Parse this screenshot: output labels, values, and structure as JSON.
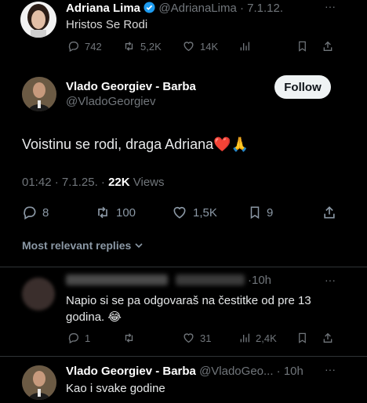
{
  "tweet1": {
    "name": "Adriana Lima",
    "handle_time": "@AdrianaLima · 7.1.12.",
    "text": "Hristos Se Rodi",
    "replies": "742",
    "retweets": "5,2K",
    "likes": "14K",
    "more": "···"
  },
  "main": {
    "name": "Vlado Georgiev - Barba",
    "handle": "@VladoGeorgiev",
    "follow_label": "Follow",
    "text": "Voistinu se rodi, draga Adriana",
    "emoji": "❤️🙏",
    "meta_time": "01:42 · 7.1.25. · ",
    "views_count": "22K",
    "views_label": " Views",
    "replies": "8",
    "retweets": "100",
    "likes": "1,5K",
    "bookmarks": "9"
  },
  "sort_label": "Most relevant replies",
  "reply1": {
    "time": "·10h",
    "text": "Napio si se pa odgovaraš na čestitke od pre 13 godina. 😂",
    "replies": "1",
    "likes": "31",
    "views": "2,4K",
    "more": "···"
  },
  "reply2": {
    "name": "Vlado Georgiev - Barba",
    "handle_time": "@VladoGeo... · 10h",
    "text": "Kao i svake godine",
    "more": "···"
  },
  "colors": {
    "verified": "#1d9bf0",
    "heart": "#e0245e",
    "background": "#000000"
  }
}
